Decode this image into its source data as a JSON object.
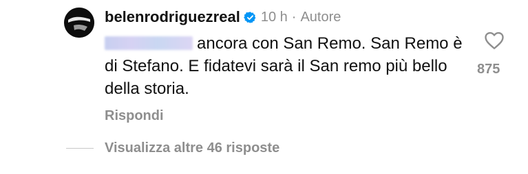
{
  "comment": {
    "username": "belenrodriguezreal",
    "time": "10 h",
    "separator": "·",
    "author_label": "Autore",
    "text": "ancora con San Remo. San Remo è di Stefano. E fidatevi sarà il San remo più bello della storia.",
    "reply_label": "Rispondi",
    "view_replies_label": "Visualizza altre 46 risposte",
    "like_count": "875",
    "icons": {
      "verified": "verified-badge-icon",
      "like": "heart-outline-icon"
    },
    "colors": {
      "verified": "#0095f6",
      "secondary_text": "#8e8e8e",
      "primary_text": "#111111"
    }
  }
}
